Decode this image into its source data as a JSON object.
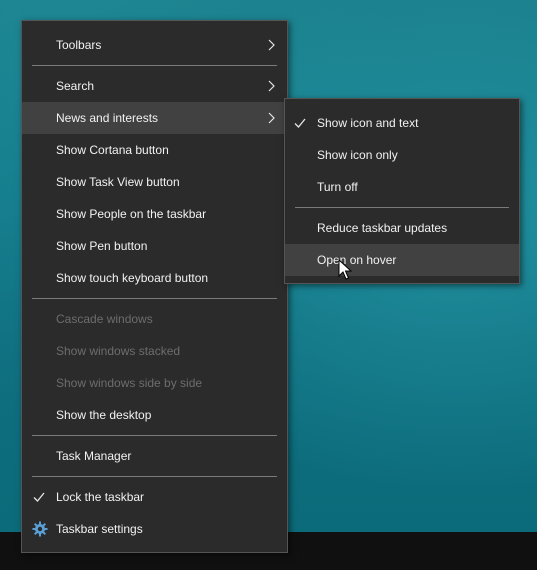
{
  "menu": {
    "items": [
      {
        "label": "Toolbars",
        "submenu": true,
        "enabled": true
      },
      {
        "label": "Search",
        "submenu": true,
        "enabled": true
      },
      {
        "label": "News and interests",
        "submenu": true,
        "enabled": true,
        "highlighted": true
      },
      {
        "label": "Show Cortana button",
        "enabled": true
      },
      {
        "label": "Show Task View button",
        "enabled": true
      },
      {
        "label": "Show People on the taskbar",
        "enabled": true
      },
      {
        "label": "Show Pen button",
        "enabled": true
      },
      {
        "label": "Show touch keyboard button",
        "enabled": true
      },
      {
        "label": "Cascade windows",
        "enabled": false
      },
      {
        "label": "Show windows stacked",
        "enabled": false
      },
      {
        "label": "Show windows side by side",
        "enabled": false
      },
      {
        "label": "Show the desktop",
        "enabled": true
      },
      {
        "label": "Task Manager",
        "enabled": true
      },
      {
        "label": "Lock the taskbar",
        "enabled": true,
        "checked": true
      },
      {
        "label": "Taskbar settings",
        "enabled": true,
        "icon": "gear-icon"
      }
    ]
  },
  "submenu": {
    "items": [
      {
        "label": "Show icon and text",
        "checked": true
      },
      {
        "label": "Show icon only"
      },
      {
        "label": "Turn off"
      },
      {
        "label": "Reduce taskbar updates"
      },
      {
        "label": "Open on hover",
        "highlighted": true
      }
    ]
  },
  "colors": {
    "menu_bg": "#2b2b2b",
    "highlight": "#414141",
    "text": "#f2f2f2",
    "disabled_text": "#6d6d6d",
    "desktop": "#13798a"
  }
}
